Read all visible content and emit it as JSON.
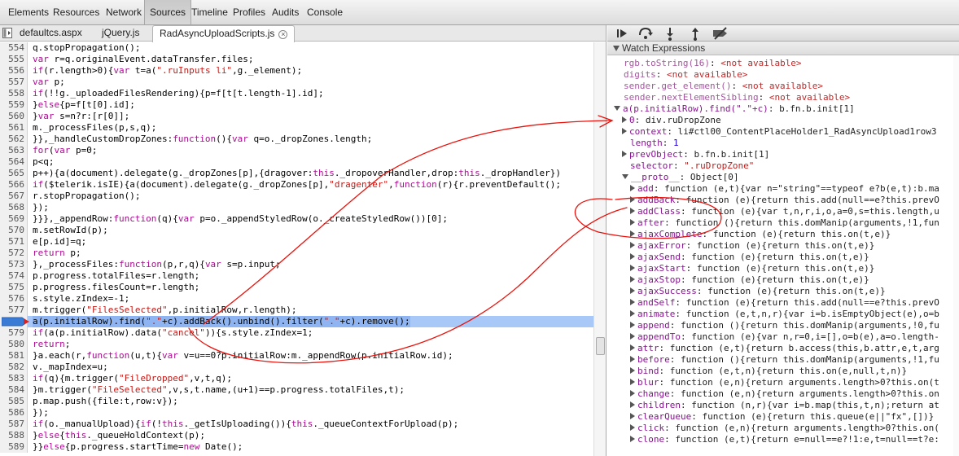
{
  "topbar": {
    "items": [
      "Elements",
      "Resources",
      "Network",
      "Sources",
      "Timeline",
      "Profiles",
      "Audits",
      "Console"
    ],
    "active_index": 3
  },
  "tabs": {
    "files": [
      "defaultcs.aspx",
      "jQuery.js",
      "RadAsyncUploadScripts.js"
    ],
    "active_index": 2,
    "close_glyph": "×"
  },
  "code": {
    "current_line": 578,
    "lines": [
      {
        "n": "554",
        "t": "q.stopPropagation();"
      },
      {
        "n": "555",
        "t": "var r=q.originalEvent.dataTransfer.files;"
      },
      {
        "n": "556",
        "t": "if(r.length>0){var t=a(\".ruInputs li\",g._element);"
      },
      {
        "n": "557",
        "t": "var p;"
      },
      {
        "n": "558",
        "t": "if(!!g._uploadedFilesRendering){p=f[t[t.length-1].id];"
      },
      {
        "n": "559",
        "t": "}else{p=f[t[0].id];"
      },
      {
        "n": "560",
        "t": "}var s=n?r:[r[0]];"
      },
      {
        "n": "561",
        "t": "m._processFiles(p,s,q);"
      },
      {
        "n": "562",
        "t": "}},_handleCustomDropZones:function(){var q=o._dropZones.length;"
      },
      {
        "n": "563",
        "t": "for(var p=0;"
      },
      {
        "n": "564",
        "t": "p<q;"
      },
      {
        "n": "565",
        "t": "p++){a(document).delegate(g._dropZones[p],{dragover:this._dropoverHandler,drop:this._dropHandler})"
      },
      {
        "n": "566",
        "t": "if($telerik.isIE){a(document).delegate(g._dropZones[p],\"dragenter\",function(r){r.preventDefault();"
      },
      {
        "n": "567",
        "t": "r.stopPropagation();"
      },
      {
        "n": "568",
        "t": "});"
      },
      {
        "n": "569",
        "t": "}}},_appendRow:function(q){var p=o._appendStyledRow(o._createStyledRow())[0];"
      },
      {
        "n": "570",
        "t": "m.setRowId(p);"
      },
      {
        "n": "571",
        "t": "e[p.id]=q;"
      },
      {
        "n": "572",
        "t": "return p;"
      },
      {
        "n": "573",
        "t": "},_processFiles:function(p,r,q){var s=p.input;"
      },
      {
        "n": "574",
        "t": "p.progress.totalFiles=r.length;"
      },
      {
        "n": "575",
        "t": "p.progress.filesCount=r.length;"
      },
      {
        "n": "576",
        "t": "s.style.zIndex=-1;"
      },
      {
        "n": "577",
        "t": "m.trigger(\"FilesSelected\",p.initialRow,r.length);"
      },
      {
        "n": "578",
        "t": "a(p.initialRow).find(\".\"+c).addBack().unbind().filter(\".\"+c).remove();"
      },
      {
        "n": "579",
        "t": "if(a(p.initialRow).data(\"cancel\")){s.style.zIndex=1;"
      },
      {
        "n": "580",
        "t": "return;"
      },
      {
        "n": "581",
        "t": "}a.each(r,function(u,t){var v=u==0?p.initialRow:m._appendRow(p.initialRow.id);"
      },
      {
        "n": "582",
        "t": "v._mapIndex=u;"
      },
      {
        "n": "583",
        "t": "if(q){m.trigger(\"FileDropped\",v,t,q);"
      },
      {
        "n": "584",
        "t": "}m.trigger(\"FileSelected\",v,s,t.name,(u+1)==p.progress.totalFiles,t);"
      },
      {
        "n": "585",
        "t": "p.map.push({file:t,row:v});"
      },
      {
        "n": "586",
        "t": "});"
      },
      {
        "n": "587",
        "t": "if(o._manualUpload){if(!this._getIsUploading()){this._queueContextForUpload(p);"
      },
      {
        "n": "588",
        "t": "}else{this._queueHoldContext(p);"
      },
      {
        "n": "589",
        "t": "}}else{p.progress.startTime=new Date();"
      }
    ]
  },
  "watch": {
    "title": "Watch Expressions",
    "na": "<not available>",
    "unavailable": [
      "rgb.toString(16)",
      "digits",
      "sender.get_element()",
      "sender.nextElementSibling"
    ],
    "main_expr": "a(p.initialRow).find(\".\"+c)",
    "main_val": "b.fn.b.init[1]",
    "props": [
      {
        "k": "0",
        "v": "div.ruDropZone",
        "exp": true
      },
      {
        "k": "context",
        "v": "li#ctl00_ContentPlaceHolder1_RadAsyncUpload1row3",
        "exp": true
      },
      {
        "k": "length",
        "v": "1",
        "num": true
      },
      {
        "k": "prevObject",
        "v": "b.fn.b.init[1]",
        "exp": true
      },
      {
        "k": "selector",
        "v": "\".ruDropZone\"",
        "str": true
      }
    ],
    "proto_key": "__proto__",
    "proto_val": "Object[0]",
    "proto_props": [
      {
        "k": "add",
        "v": "function (e,t){var n=\"string\"==typeof e?b(e,t):b.ma"
      },
      {
        "k": "addBack",
        "v": "function (e){return this.add(null==e?this.prevO"
      },
      {
        "k": "addClass",
        "v": "function (e){var t,n,r,i,o,a=0,s=this.length,u"
      },
      {
        "k": "after",
        "v": "function (){return this.domManip(arguments,!1,fun"
      },
      {
        "k": "ajaxComplete",
        "v": "function (e){return this.on(t,e)}"
      },
      {
        "k": "ajaxError",
        "v": "function (e){return this.on(t,e)}"
      },
      {
        "k": "ajaxSend",
        "v": "function (e){return this.on(t,e)}"
      },
      {
        "k": "ajaxStart",
        "v": "function (e){return this.on(t,e)}"
      },
      {
        "k": "ajaxStop",
        "v": "function (e){return this.on(t,e)}"
      },
      {
        "k": "ajaxSuccess",
        "v": "function (e){return this.on(t,e)}"
      },
      {
        "k": "andSelf",
        "v": "function (e){return this.add(null==e?this.prevO"
      },
      {
        "k": "animate",
        "v": "function (e,t,n,r){var i=b.isEmptyObject(e),o=b"
      },
      {
        "k": "append",
        "v": "function (){return this.domManip(arguments,!0,fu"
      },
      {
        "k": "appendTo",
        "v": "function (e){var n,r=0,i=[],o=b(e),a=o.length-"
      },
      {
        "k": "attr",
        "v": "function (e,t){return b.access(this,b.attr,e,t,arg"
      },
      {
        "k": "before",
        "v": "function (){return this.domManip(arguments,!1,fu"
      },
      {
        "k": "bind",
        "v": "function (e,t,n){return this.on(e,null,t,n)}"
      },
      {
        "k": "blur",
        "v": "function (e,n){return arguments.length>0?this.on(t"
      },
      {
        "k": "change",
        "v": "function (e,n){return arguments.length>0?this.on"
      },
      {
        "k": "children",
        "v": "function (n,r){var i=b.map(this,t,n);return at"
      },
      {
        "k": "clearQueue",
        "v": "function (e){return this.queue(e||\"fx\",[])}"
      },
      {
        "k": "click",
        "v": "function (e,n){return arguments.length>0?this.on("
      },
      {
        "k": "clone",
        "v": "function (e,t){return e=null==e?!1:e,t=null==t?e:"
      }
    ]
  },
  "colors": {
    "exec_line": "#a8c8f7",
    "annotation": "#e8120c",
    "keyword": "#aa0d91",
    "string": "#c41a16"
  }
}
